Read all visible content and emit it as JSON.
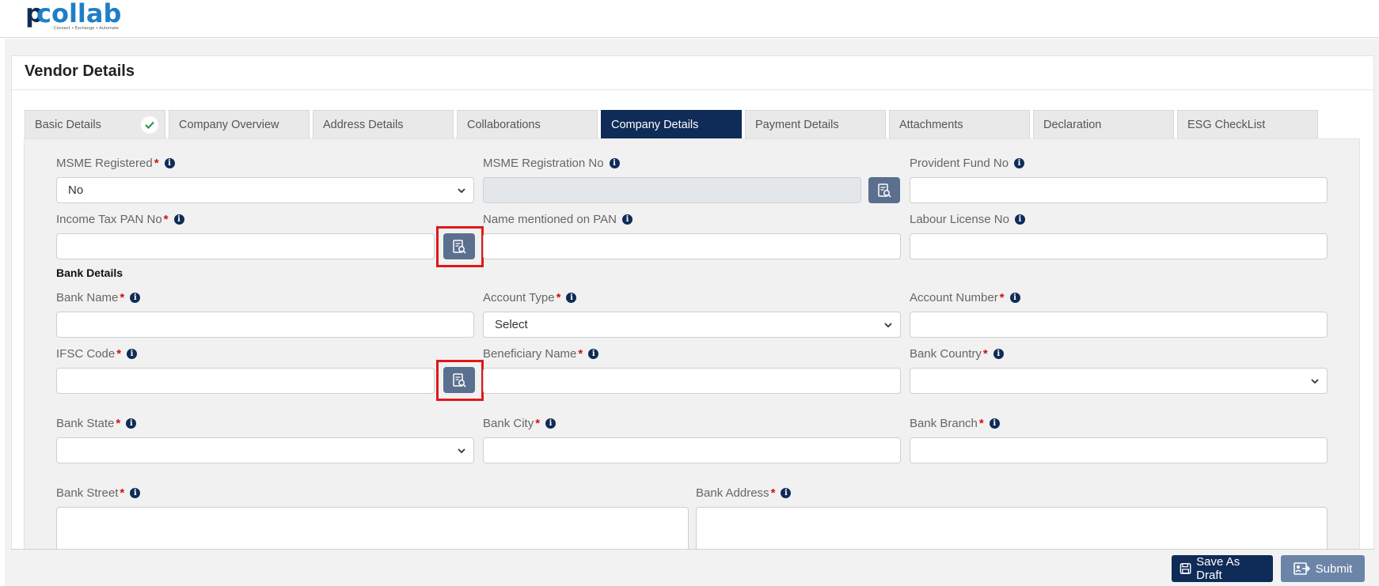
{
  "app": {
    "logo_text": "collab",
    "logo_tagline": "Connect • Exchange • Automate"
  },
  "page": {
    "title": "Vendor Details"
  },
  "tabs": [
    {
      "label": "Basic Details",
      "completed": true
    },
    {
      "label": "Company Overview"
    },
    {
      "label": "Address Details"
    },
    {
      "label": "Collaborations"
    },
    {
      "label": "Company Details",
      "active": true
    },
    {
      "label": "Payment Details"
    },
    {
      "label": "Attachments"
    },
    {
      "label": "Declaration"
    },
    {
      "label": "ESG CheckList"
    }
  ],
  "fields": {
    "msme_registered": {
      "label": "MSME Registered",
      "value": "No"
    },
    "msme_registration_no": {
      "label": "MSME Registration No"
    },
    "provident_fund_no": {
      "label": "Provident Fund No"
    },
    "income_tax_pan": {
      "label": "Income Tax PAN No"
    },
    "name_on_pan": {
      "label": "Name mentioned on PAN"
    },
    "labour_license_no": {
      "label": "Labour License No"
    },
    "bank_name": {
      "label": "Bank Name"
    },
    "account_type": {
      "label": "Account Type",
      "value": "Select"
    },
    "account_number": {
      "label": "Account Number"
    },
    "ifsc_code": {
      "label": "IFSC Code"
    },
    "beneficiary_name": {
      "label": "Beneficiary Name"
    },
    "bank_country": {
      "label": "Bank Country"
    },
    "bank_state": {
      "label": "Bank State"
    },
    "bank_city": {
      "label": "Bank City"
    },
    "bank_branch": {
      "label": "Bank Branch"
    },
    "bank_street": {
      "label": "Bank Street"
    },
    "bank_address": {
      "label": "Bank Address"
    }
  },
  "sections": {
    "bank_details": "Bank Details"
  },
  "footer": {
    "save_draft": "Save As Draft",
    "submit": "Submit"
  },
  "colors": {
    "primary": "#0f2b57",
    "lookup": "#5b6f8f",
    "required": "#d01010",
    "highlight": "#e01818"
  }
}
